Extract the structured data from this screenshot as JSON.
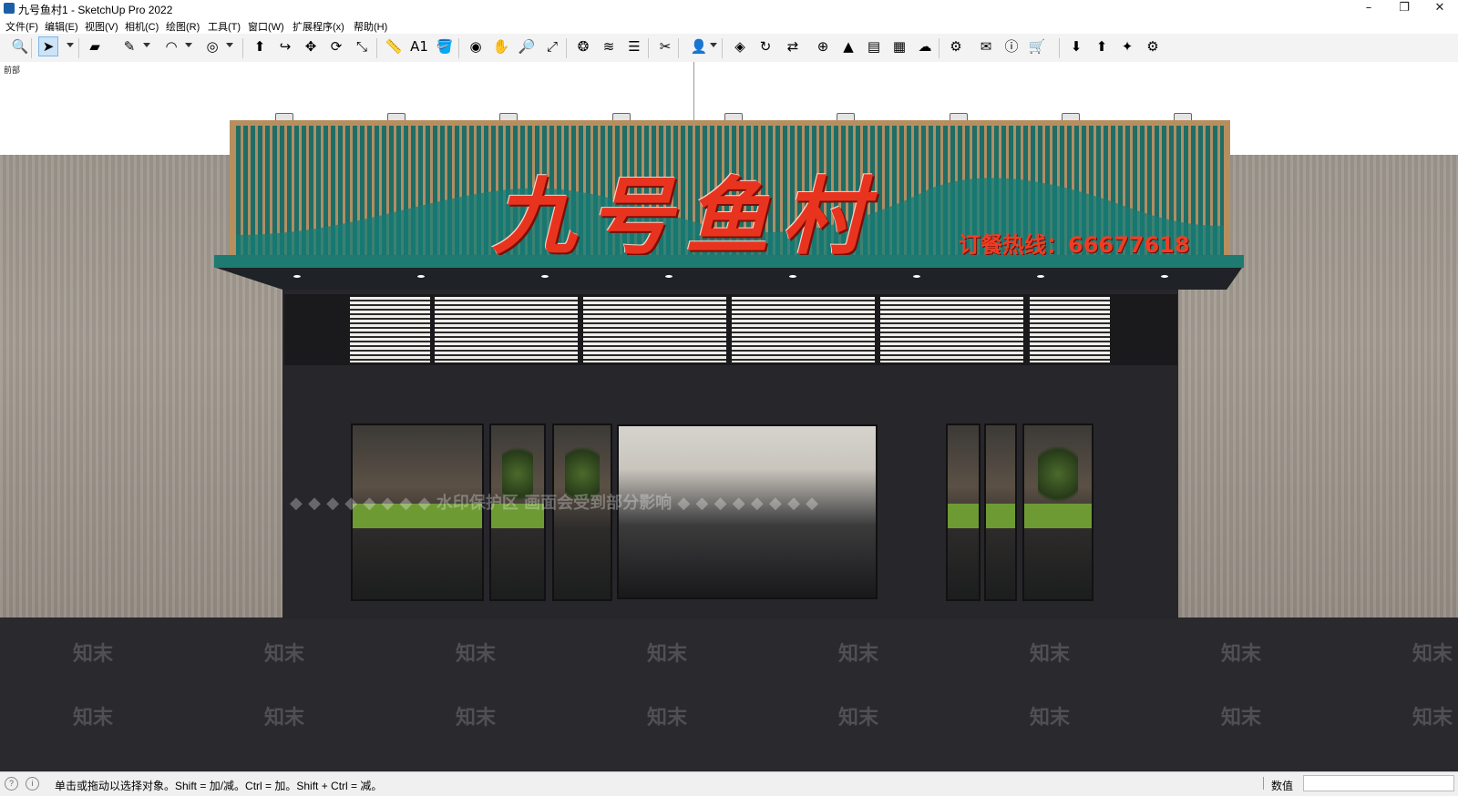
{
  "window": {
    "title": "九号鱼村1 - SketchUp Pro 2022",
    "minimize": "–",
    "restore": "❐",
    "close": "✕"
  },
  "menu": [
    "文件(F)",
    "编辑(E)",
    "视图(V)",
    "相机(C)",
    "绘图(R)",
    "工具(T)",
    "窗口(W)",
    "扩展程序(x)",
    "帮助(H)"
  ],
  "toolbar_icons": [
    {
      "name": "zoom-tool",
      "glyph": "🔍"
    },
    {
      "name": "select-tool",
      "glyph": "➤"
    },
    {
      "name": "eraser-tool",
      "glyph": "▰"
    },
    {
      "name": "pencil-tool",
      "glyph": "✎"
    },
    {
      "name": "arc-tool",
      "glyph": "◠"
    },
    {
      "name": "shapes-tool",
      "glyph": "◎"
    },
    {
      "name": "push-pull-tool",
      "glyph": "⬆"
    },
    {
      "name": "follow-me-tool",
      "glyph": "↪"
    },
    {
      "name": "move-tool",
      "glyph": "✥"
    },
    {
      "name": "rotate-tool",
      "glyph": "⟳"
    },
    {
      "name": "scale-tool",
      "glyph": "⤡"
    },
    {
      "name": "tape-measure-tool",
      "glyph": "📏"
    },
    {
      "name": "text-tool",
      "glyph": "A1"
    },
    {
      "name": "paint-bucket-tool",
      "glyph": "🪣"
    },
    {
      "name": "orbit-tool",
      "glyph": "◉"
    },
    {
      "name": "pan-tool",
      "glyph": "✋"
    },
    {
      "name": "zoom-window-tool",
      "glyph": "🔎"
    },
    {
      "name": "zoom-extents-tool",
      "glyph": "⤢"
    },
    {
      "name": "warehouse-tool",
      "glyph": "❂"
    },
    {
      "name": "sandbox-tool",
      "glyph": "≋"
    },
    {
      "name": "layers-tool",
      "glyph": "☰"
    },
    {
      "name": "section-tool",
      "glyph": "✂"
    },
    {
      "name": "account-tool",
      "glyph": "👤"
    },
    {
      "name": "extension-a",
      "glyph": "◈"
    },
    {
      "name": "refresh-tool",
      "glyph": "↻"
    },
    {
      "name": "swap-tool",
      "glyph": "⇄"
    },
    {
      "name": "add-tool",
      "glyph": "⊕"
    },
    {
      "name": "tree-tool",
      "glyph": "▲"
    },
    {
      "name": "stack-tool",
      "glyph": "▤"
    },
    {
      "name": "pattern-tool",
      "glyph": "▦"
    },
    {
      "name": "cloud-upload-tool",
      "glyph": "☁"
    },
    {
      "name": "settings-tool",
      "glyph": "⚙"
    },
    {
      "name": "mail-tool",
      "glyph": "✉"
    },
    {
      "name": "info-tool",
      "glyph": "ⓘ"
    },
    {
      "name": "cart-tool",
      "glyph": "🛒"
    },
    {
      "name": "download-tool",
      "glyph": "⬇"
    },
    {
      "name": "upload-tool",
      "glyph": "⬆"
    },
    {
      "name": "render-tool",
      "glyph": "✦"
    },
    {
      "name": "gear-tool",
      "glyph": "⚙"
    }
  ],
  "viewport": {
    "scene_tab": "前部",
    "sign_title": "九号鱼村",
    "sign_hotline": "订餐热线：66677618",
    "watermark_banner": "◆ ◆ ◆ ◆ ◆ ◆ ◆ ◆ 水印保护区  画面会受到部分影响 ◆ ◆ ◆ ◆ ◆ ◆ ◆ ◆",
    "watermark_text": "知末"
  },
  "status": {
    "hint": "单击或拖动以选择对象。Shift = 加/减。Ctrl = 加。Shift + Ctrl = 减。",
    "measure_label": "数值",
    "measure_value": ""
  },
  "colors": {
    "sign_teal": "#1f6d66",
    "sign_red": "#e8341f",
    "facade": "#27262b"
  }
}
